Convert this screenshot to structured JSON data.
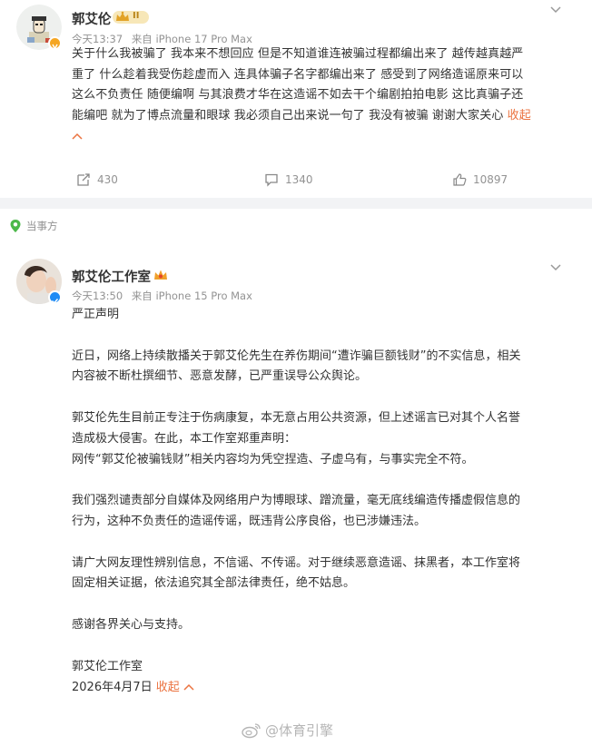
{
  "post1": {
    "username": "郭艾伦",
    "level_badge": "II",
    "time": "今天13:37",
    "source": "来自 iPhone 17 Pro Max",
    "lines": [
      "关于什么我被骗了 我本来不想回应 但是不知道谁连被骗过程都编出来了 越传越真越严",
      "重了 什么趁着我受伤趁虚而入 连具体骗子名字都编出来了 感受到了网络造谣原来可以",
      "这么不负责任 随便编啊 与其浪费才华在这造谣不如去干个编剧拍拍电影 这比真骗子还",
      "能编吧 就为了博点流量和眼球 我必须自己出来说一句了 我没有被骗 谢谢大家关心 "
    ],
    "fold_label": "收起",
    "fold_arrow": "^",
    "reposts": "430",
    "comments": "1340",
    "likes": "10897"
  },
  "tag_label": "当事方",
  "post2": {
    "username": "郭艾伦工作室",
    "time": "今天13:50",
    "source": "来自 iPhone 15 Pro Max",
    "title": "严正声明",
    "paragraphs": [
      [
        "近日，网络上持续散播关于郭艾伦先生在养伤期间“遭诈骗巨额钱财”的不实信息，相关",
        "内容被不断杜撰细节、恶意发酵，已严重误导公众舆论。"
      ],
      [
        "郭艾伦先生目前正专注于伤病康复，本无意占用公共资源，但上述谣言已对其个人名誉",
        "造成极大侵害。在此，本工作室郑重声明：",
        "网传“郭艾伦被骗钱财”相关内容均为凭空捏造、子虚乌有，与事实完全不符。"
      ],
      [
        "我们强烈谴责部分自媒体及网络用户为博眼球、蹭流量，毫无底线编造传播虚假信息的",
        "行为，这种不负责任的造谣传谣，既违背公序良俗，也已涉嫌违法。"
      ],
      [
        "请广大网友理性辨别信息，不信谣、不传谣。对于继续恶意造谣、抹黑者，本工作室将",
        "固定相关证据，依法追究其全部法律责任，绝不姑息。"
      ],
      [
        "感谢各界关心与支持。"
      ]
    ],
    "signature": "郭艾伦工作室",
    "date": "2026年4月7日",
    "fold_label": "收起",
    "fold_arrow": "^"
  },
  "watermark": "@体育引擎",
  "colors": {
    "accent": "#eb7340",
    "verified_orange": "#f5a623",
    "verified_blue": "#1f8bf5",
    "tag_green": "#4cb84a",
    "meta_gray": "#939393"
  }
}
